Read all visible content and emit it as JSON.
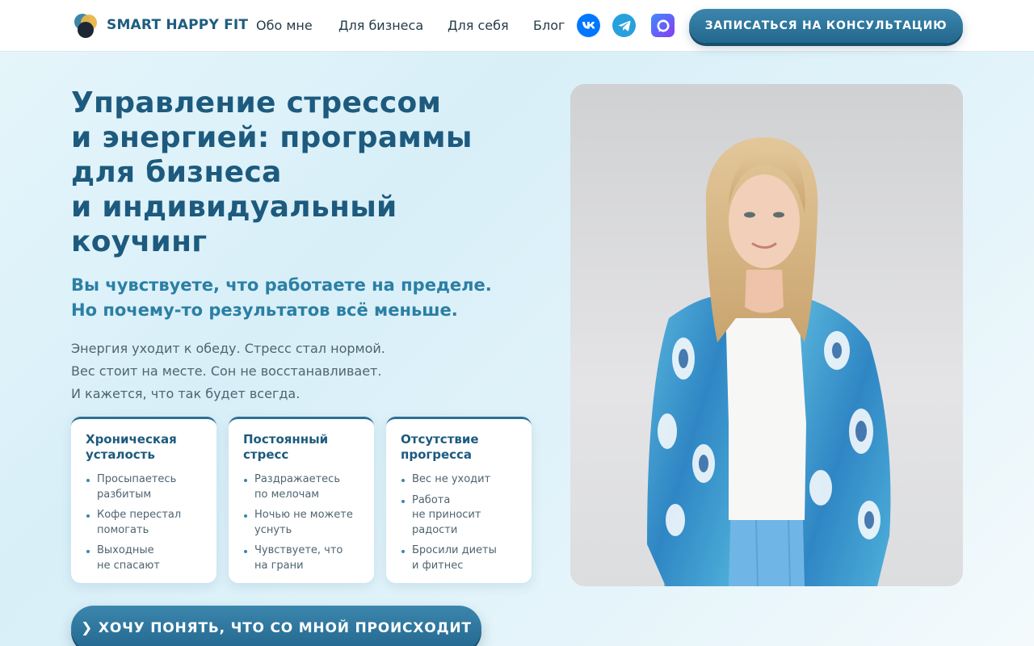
{
  "header": {
    "brand": "SMART HAPPY FIT",
    "nav": [
      {
        "label": "Обо мне"
      },
      {
        "label": "Для бизнеса"
      },
      {
        "label": "Для себя"
      },
      {
        "label": "Блог"
      }
    ],
    "social": [
      {
        "icon": "vk-icon",
        "color": "#0077ff"
      },
      {
        "icon": "telegram-icon",
        "color": "#27a0dd"
      },
      {
        "icon": "max-messenger-icon",
        "color": "#6a5cf5"
      }
    ],
    "cta_label": "ЗАПИСАТЬСЯ НА КОНСУЛЬТАЦИЮ"
  },
  "hero": {
    "title": "Управление стрессом\nи энергией: программы\nдля бизнеса\nи индивидуальный\nкоучинг",
    "subtitle": "Вы чувствуете, что работаете на пределе.\nНо почему-то результатов всё меньше.",
    "paragraph": "Энергия уходит к обеду. Стресс стал нормой.\nВес стоит на месте. Сон не восстанавливает.\nИ кажется, что так будет всегда.",
    "cards": [
      {
        "title": "Хроническая\nусталость",
        "items": [
          "Просыпаетесь\nразбитым",
          "Кофе перестал\nпомогать",
          "Выходные\nне спасают"
        ]
      },
      {
        "title": "Постоянный\nстресс",
        "items": [
          "Раздражаетесь\nпо мелочам",
          "Ночью не можете\nуснуть",
          "Чувствуете, что\nна грани"
        ]
      },
      {
        "title": "Отсутствие\nпрогресса",
        "items": [
          "Вес не уходит",
          "Работа\nне приносит\nрадости",
          "Бросили диеты\nи фитнес"
        ]
      }
    ],
    "cta_label": "❯ ХОЧУ ПОНЯТЬ, ЧТО СО МНОЙ ПРОИСХОДИТ"
  },
  "colors": {
    "primary": "#1d5a7e",
    "accent": "#2b7fa4",
    "button": "#22678e"
  }
}
